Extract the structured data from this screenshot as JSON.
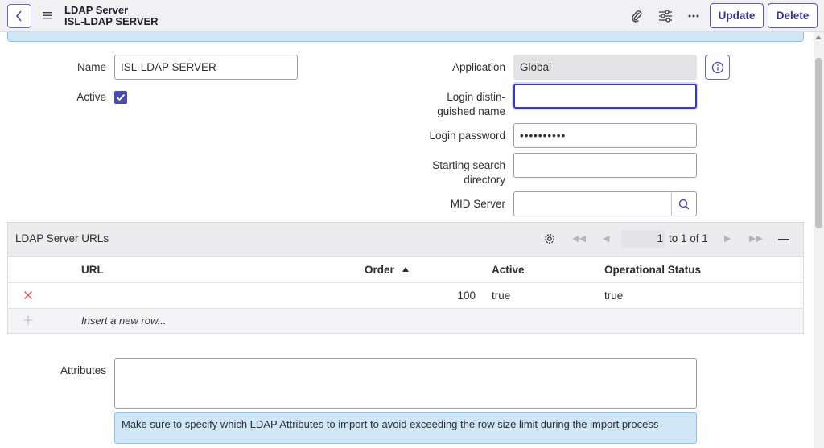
{
  "header": {
    "title": "LDAP Server",
    "subtitle": "ISL-LDAP SERVER",
    "update_label": "Update",
    "delete_label": "Delete"
  },
  "form": {
    "name_label": "Name",
    "name_value": "ISL-LDAP SERVER",
    "active_label": "Active",
    "active_checked": true,
    "application_label": "Application",
    "application_value": "Global",
    "login_dn_label_line1": "Login distin-",
    "login_dn_label_line2": "guished name",
    "login_dn_value": "",
    "login_password_label": "Login password",
    "login_password_value": "••••••••••",
    "starting_search_label_line1": "Starting search",
    "starting_search_label_line2": "directory",
    "starting_search_value": "",
    "mid_server_label": "MID Server",
    "mid_server_value": "",
    "attributes_label": "Attributes",
    "attributes_value": ""
  },
  "related_list": {
    "title": "LDAP Server URLs",
    "pager_current": "1",
    "pager_text": "to 1 of 1",
    "columns": [
      "URL",
      "Order",
      "Active",
      "Operational Status"
    ],
    "rows": [
      {
        "url": "",
        "order": "100",
        "active": "true",
        "operational_status": "true"
      }
    ],
    "insert_row_label": "Insert a new row..."
  },
  "attributes_message": "Make sure to specify which LDAP Attributes to import to avoid exceeding the row size limit during the import process",
  "colors": {
    "accent": "#4a4aa8",
    "info_bg": "#cfe7f6",
    "delete_x": "#e05252"
  }
}
